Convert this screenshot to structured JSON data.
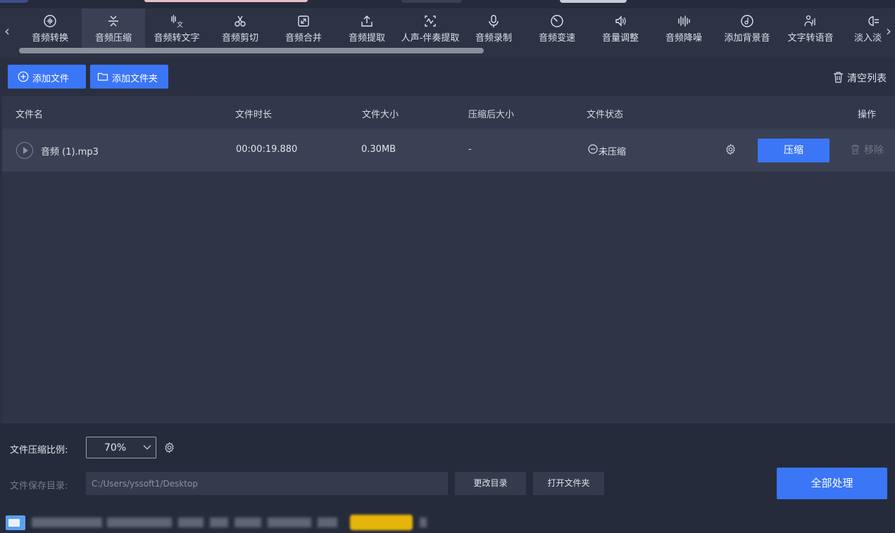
{
  "nav": {
    "tools": [
      {
        "label": "音频转换",
        "icon": "audio-convert-icon"
      },
      {
        "label": "音频压缩",
        "icon": "audio-compress-icon",
        "active": true
      },
      {
        "label": "音频转文字",
        "icon": "audio-to-text-icon"
      },
      {
        "label": "音频剪切",
        "icon": "scissors-icon"
      },
      {
        "label": "音频合并",
        "icon": "merge-icon"
      },
      {
        "label": "音频提取",
        "icon": "extract-icon"
      },
      {
        "label": "人声-伴奏提取",
        "icon": "vocal-extract-icon"
      },
      {
        "label": "音频录制",
        "icon": "microphone-icon"
      },
      {
        "label": "音频变速",
        "icon": "speed-icon"
      },
      {
        "label": "音量调整",
        "icon": "volume-icon"
      },
      {
        "label": "音频降噪",
        "icon": "denoise-icon"
      },
      {
        "label": "添加背景音",
        "icon": "background-music-icon"
      },
      {
        "label": "文字转语音",
        "icon": "text-to-speech-icon"
      },
      {
        "label": "淡入淡",
        "icon": "fade-icon"
      }
    ]
  },
  "toolbar": {
    "add_file": "添加文件",
    "add_folder": "添加文件夹",
    "clear_list": "清空列表"
  },
  "table": {
    "headers": {
      "name": "文件名",
      "duration": "文件时长",
      "size": "文件大小",
      "compressed_size": "压缩后大小",
      "status": "文件状态",
      "action": "操作"
    },
    "rows": [
      {
        "name": "音频 (1).mp3",
        "duration": "00:00:19.880",
        "size": "0.30MB",
        "compressed_size": "-",
        "status": "未压缩",
        "compress_label": "压缩",
        "remove_label": "移除"
      }
    ]
  },
  "bottom": {
    "ratio_label": "文件压缩比例:",
    "ratio_value": "70%",
    "dir_label": "文件保存目录:",
    "dir_value": "C:/Users/yssoft1/Desktop",
    "change_dir": "更改目录",
    "open_folder": "打开文件夹",
    "process_all": "全部处理"
  },
  "colors": {
    "accent": "#3b76f6",
    "background": "#2a3042",
    "panel": "#2f3547",
    "row_highlight": "#3a4154"
  }
}
